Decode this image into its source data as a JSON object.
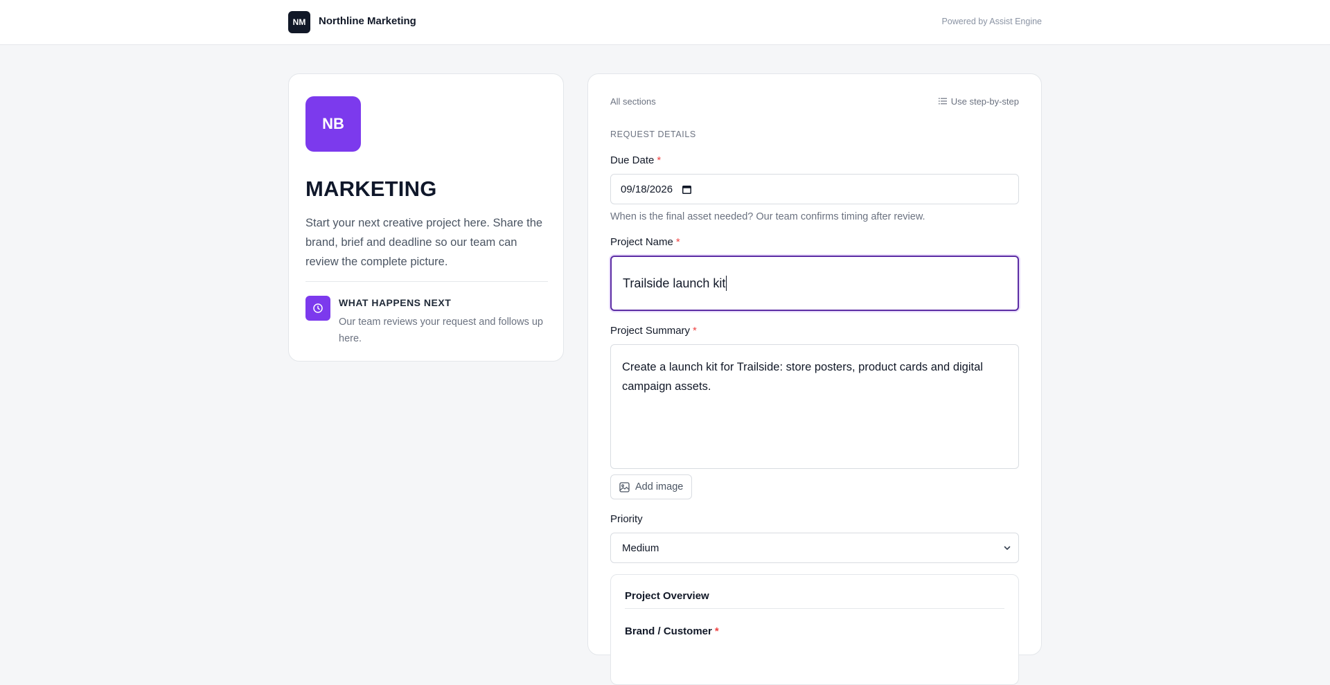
{
  "header": {
    "logo_initials": "NM",
    "company_name": "Northline Marketing",
    "powered_by": "Powered by Assist Engine"
  },
  "intro": {
    "avatar_initials": "NB",
    "title": "MARKETING",
    "description": "Start your next creative project here. Share the brand, brief and deadline so our team can review the complete picture.",
    "next_title": "WHAT HAPPENS NEXT",
    "next_description": "Our team reviews your request and follows up here.",
    "accent_color": "#7c3aed"
  },
  "form": {
    "all_sections_label": "All sections",
    "step_by_step_label": "Use step-by-step",
    "section_heading": "REQUEST DETAILS",
    "due_date": {
      "label": "Due Date",
      "required_mark": "*",
      "value": "09/18/2026",
      "hint": "When is the final asset needed? Our team confirms timing after review."
    },
    "project_name": {
      "label": "Project Name",
      "required_mark": "*",
      "value": "Trailside launch kit"
    },
    "project_summary": {
      "label": "Project Summary",
      "required_mark": "*",
      "value": "Create a launch kit for Trailside: store posters, product cards and digital campaign assets."
    },
    "add_image_label": "Add image",
    "priority": {
      "label": "Priority",
      "value": "Medium"
    },
    "overview": {
      "title": "Project Overview",
      "brand_label": "Brand / Customer",
      "required_mark": "*"
    }
  },
  "icons": {
    "list": "list-icon",
    "clock": "clock-icon",
    "calendar": "calendar-icon",
    "image": "image-icon",
    "chevron": "chevron-down-icon"
  }
}
